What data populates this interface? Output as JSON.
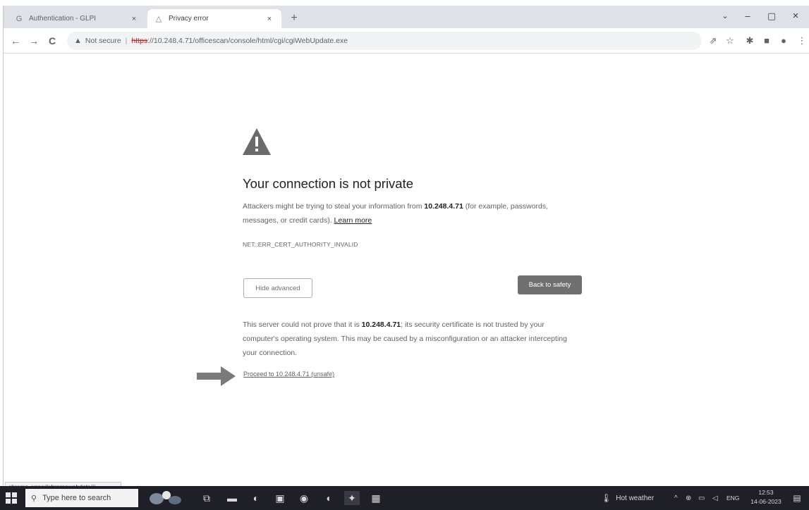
{
  "tabs": [
    {
      "title": "Authentication - GLPI",
      "favicon": "glpi-g-icon",
      "close": "×"
    },
    {
      "title": "Privacy error",
      "favicon": "warning-favicon",
      "close": "×"
    }
  ],
  "window": {
    "newtab": "+",
    "minimize": "–",
    "restore": "▢",
    "close": "×",
    "tabsearch": "⌄"
  },
  "toolbar": {
    "back": "←",
    "forward": "→",
    "reload": "C",
    "not_secure": "Not secure",
    "separator": "|",
    "url_scheme": "https",
    "url_rest": "://10.248.4.71/officescan/console/html/cgi/cgiWebUpdate.exe",
    "icons": [
      "share-icon",
      "star-icon",
      "extensions-icon",
      "sidepanel-icon",
      "profile-icon",
      "menu-icon"
    ]
  },
  "page": {
    "heading": "Your connection is not private",
    "p1_part1": "Attackers might be trying to steal your information from ",
    "p1_host": "10.248.4.71",
    "p1_part2": " (for example, passwords, messages, or credit cards). ",
    "learn_more": "Learn more",
    "error_code": "NET::ERR_CERT_AUTHORITY_INVALID",
    "hide_advanced": "Hide advanced",
    "back_to_safety": "Back to safety",
    "p2_part1": "This server could not prove that it is ",
    "p2_host": "10.248.4.71",
    "p2_part2": "; its security certificate is not trusted by your computer's operating system. This may be caused by a misconfiguration or an attacker intercepting your connection.",
    "proceed": "Proceed to 10.248.4.71 (unsafe)"
  },
  "status_url": "chrome-error://chromewebdata/#",
  "taskbar": {
    "search_placeholder": "Type here to search",
    "search_icon": "⚲",
    "weather": "Hot weather",
    "tray_chevron": "^",
    "lang": "ENG",
    "time": "12:53",
    "date": "14-06-2023",
    "notification_icon": "▤"
  },
  "colors": {
    "tabstrip": "#dee1e6",
    "omnibox": "#f1f3f4",
    "primary_button": "#6f6f6f",
    "taskbar": "#1f1f28",
    "warning_icon": "#6b6b6b"
  }
}
